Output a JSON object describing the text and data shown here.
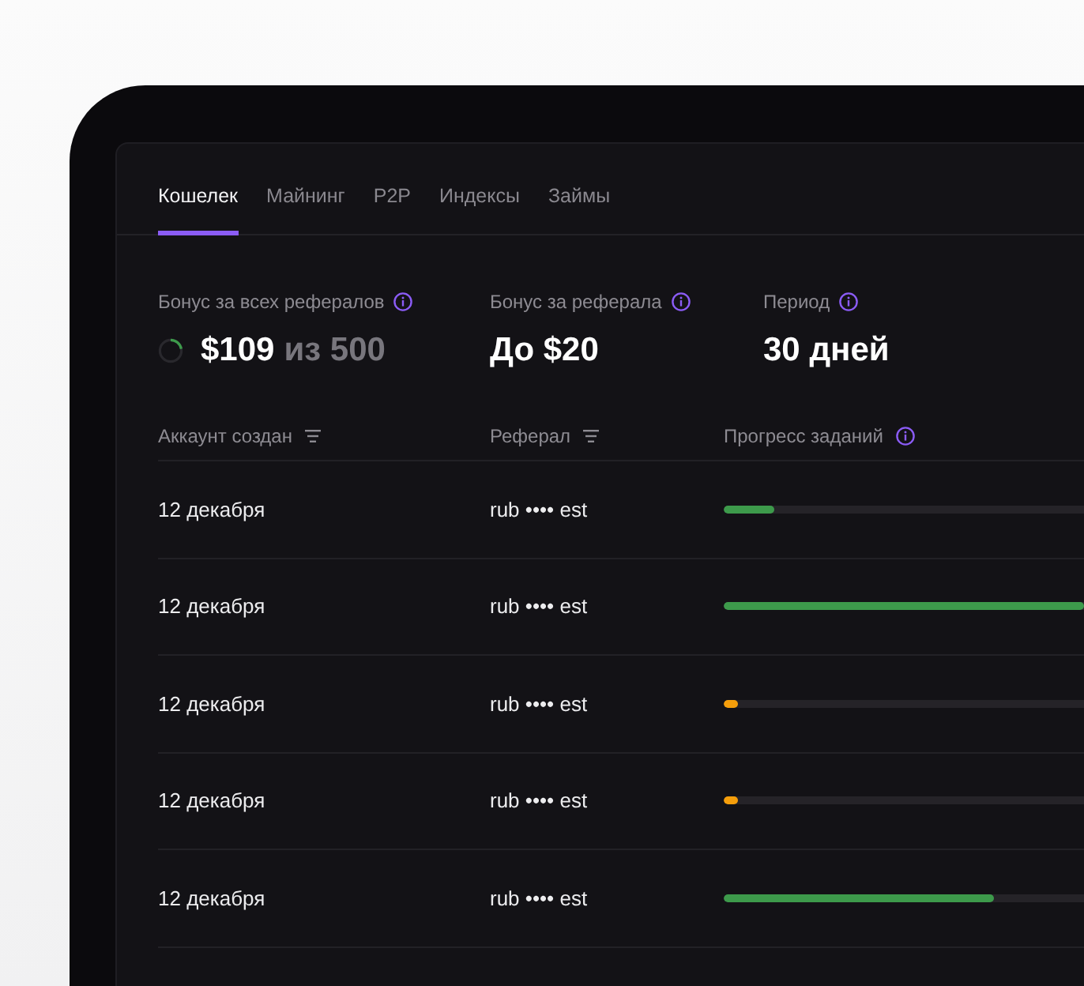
{
  "tabs": [
    {
      "label": "Кошелек",
      "selected": true
    },
    {
      "label": "Майнинг",
      "selected": false
    },
    {
      "label": "P2P",
      "selected": false
    },
    {
      "label": "Индексы",
      "selected": false
    },
    {
      "label": "Займы",
      "selected": false
    }
  ],
  "stats": [
    {
      "label": "Бонус за всех рефералов",
      "value": "$109",
      "total": "из 500",
      "level": 0.22
    },
    {
      "label": "Бонус за реферала",
      "value": "До $20"
    },
    {
      "label": "Период",
      "value": "30 дней"
    }
  ],
  "table": {
    "columns": [
      {
        "label": "Аккаунт создан",
        "kind": "filter"
      },
      {
        "label": "Реферал",
        "kind": "filter"
      },
      {
        "label": "Прогресс заданий",
        "kind": "info"
      }
    ],
    "rows": [
      {
        "created": "12 декабря",
        "referral": "rub •••• est",
        "level": 0.14,
        "color": "#3d9a4b"
      },
      {
        "created": "12 декабря",
        "referral": "rub •••• est",
        "level": 1,
        "color": "#3d9a4b"
      },
      {
        "created": "12 декабря",
        "referral": "rub •••• est",
        "level": 0.04,
        "color": "#f59e0b"
      },
      {
        "created": "12 декабря",
        "referral": "rub •••• est",
        "level": 0.04,
        "color": "#f59e0b"
      },
      {
        "created": "12 декабря",
        "referral": "rub •••• est",
        "level": 0.75,
        "color": "#3d9a4b"
      }
    ]
  }
}
